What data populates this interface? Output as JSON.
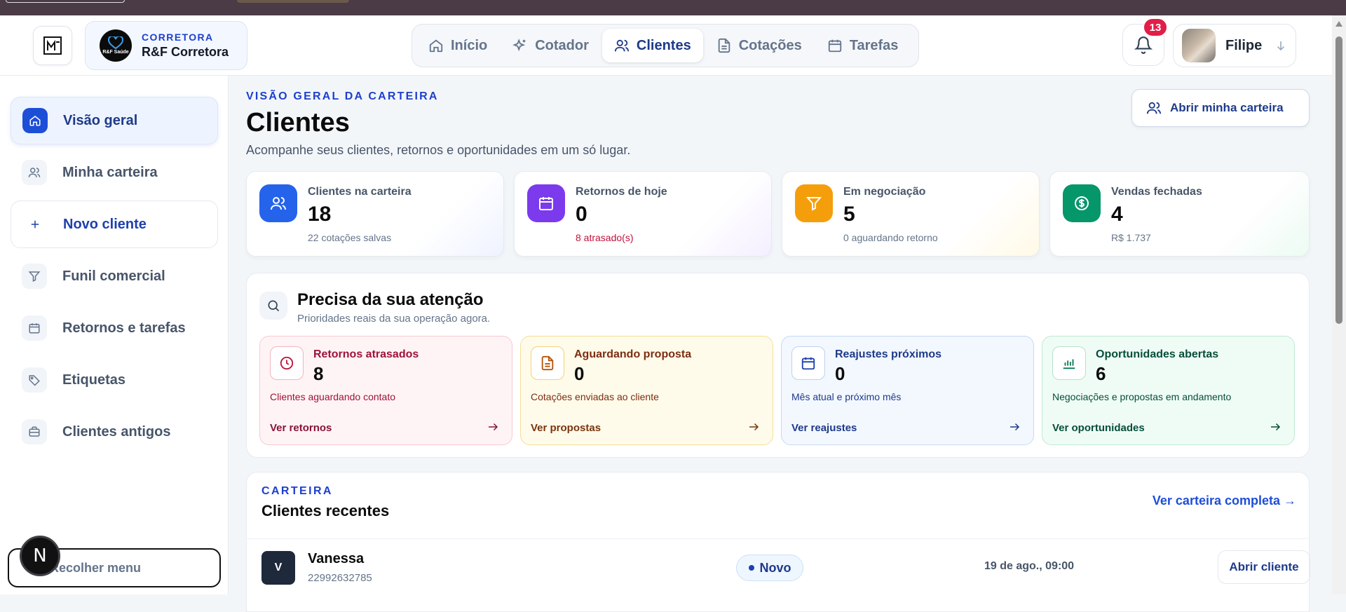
{
  "header": {
    "brand_kicker": "CORRETORA",
    "brand_name": "R&F Corretora",
    "brand_logo_text": "R&F Saúde",
    "nav": [
      {
        "label": "Início",
        "icon": "home-icon"
      },
      {
        "label": "Cotador",
        "icon": "sparkles-icon"
      },
      {
        "label": "Clientes",
        "icon": "users-icon",
        "active": true
      },
      {
        "label": "Cotações",
        "icon": "file-icon"
      },
      {
        "label": "Tarefas",
        "icon": "calendar-icon"
      }
    ],
    "notifications_count": "13",
    "user_name": "Filipe"
  },
  "sidebar": {
    "items": [
      {
        "label": "Visão geral",
        "icon": "home-icon",
        "active": true
      },
      {
        "label": "Minha carteira",
        "icon": "users-icon"
      },
      {
        "label": "Novo cliente",
        "icon": "plus-icon"
      },
      {
        "label": "Funil comercial",
        "icon": "filter-icon"
      },
      {
        "label": "Retornos e tarefas",
        "icon": "calendar-icon"
      },
      {
        "label": "Etiquetas",
        "icon": "tag-icon"
      },
      {
        "label": "Clientes antigos",
        "icon": "briefcase-icon"
      }
    ],
    "collapse_label": "Recolher menu",
    "fab_label": "N"
  },
  "main": {
    "kicker": "VISÃO GERAL DA CARTEIRA",
    "title": "Clientes",
    "subtitle": "Acompanhe seus clientes, retornos e oportunidades em um só lugar.",
    "open_wallet_label": "Abrir minha carteira",
    "stats": [
      {
        "label": "Clientes na carteira",
        "value": "18",
        "note": "22 cotações salvas",
        "color": "#2563eb",
        "icon": "users-icon"
      },
      {
        "label": "Retornos de hoje",
        "value": "0",
        "note": "8 atrasado(s)",
        "color": "#7c3aed",
        "icon": "calendar-icon",
        "note_color": "#be123c"
      },
      {
        "label": "Em negociação",
        "value": "5",
        "note": "0 aguardando retorno",
        "color": "#f59e0b",
        "icon": "filter-icon"
      },
      {
        "label": "Vendas fechadas",
        "value": "4",
        "note": "R$ 1.737",
        "color": "#059669",
        "icon": "dollar-icon"
      }
    ],
    "attention": {
      "title": "Precisa da sua atenção",
      "subtitle": "Prioridades reais da sua operação agora.",
      "cards": [
        {
          "title": "Retornos atrasados",
          "value": "8",
          "desc": "Clientes aguardando contato",
          "link": "Ver retornos",
          "icon": "clock-icon"
        },
        {
          "title": "Aguardando proposta",
          "value": "0",
          "desc": "Cotações enviadas ao cliente",
          "link": "Ver propostas",
          "icon": "document-icon"
        },
        {
          "title": "Reajustes próximos",
          "value": "0",
          "desc": "Mês atual e próximo mês",
          "link": "Ver reajustes",
          "icon": "calendar-icon"
        },
        {
          "title": "Oportunidades abertas",
          "value": "6",
          "desc": "Negociações e propostas em andamento",
          "link": "Ver oportunidades",
          "icon": "bar-chart-icon"
        }
      ]
    },
    "recent": {
      "kicker": "CARTEIRA",
      "title": "Clientes recentes",
      "link": "Ver carteira completa →",
      "rows": [
        {
          "initial": "V",
          "name": "Vanessa",
          "phone": "22992632785",
          "status": "Novo",
          "date": "19 de ago., 09:00",
          "action": "Abrir cliente"
        }
      ]
    }
  }
}
